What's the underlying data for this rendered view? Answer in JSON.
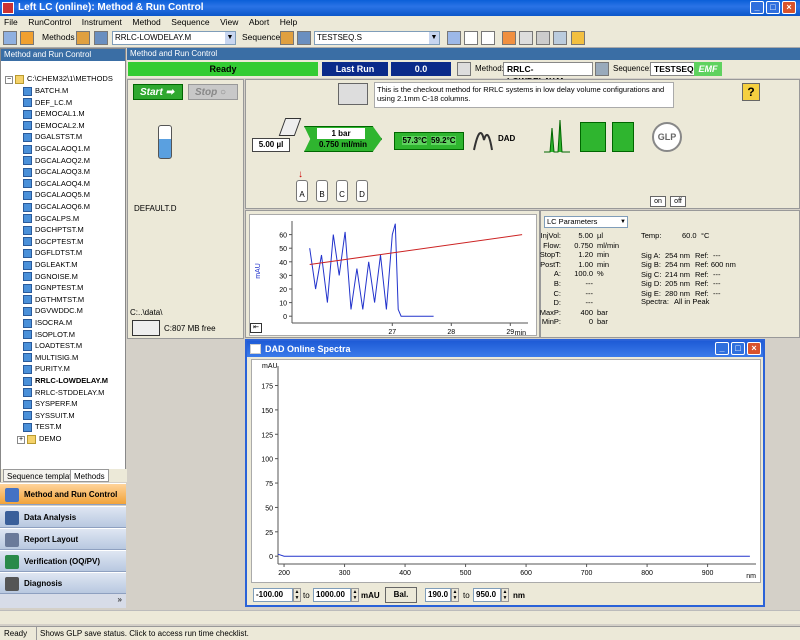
{
  "window": {
    "title": "Left LC (online): Method & Run Control"
  },
  "menu": [
    "File",
    "RunControl",
    "Instrument",
    "Method",
    "Sequence",
    "View",
    "Abort",
    "Help"
  ],
  "toolbar": {
    "methods_label": "Methods",
    "method_value": "RRLC-LOWDELAY.M",
    "sequences_label": "Sequences",
    "sequence_value": "TESTSEQ.S"
  },
  "leftpanel": {
    "header": "Method and Run Control",
    "root": "C:\\CHEM32\\1\\METHODS",
    "items": [
      "BATCH.M",
      "DEF_LC.M",
      "DEMOCAL1.M",
      "DEMOCAL2.M",
      "DGALSTST.M",
      "DGCALAOQ1.M",
      "DGCALAOQ2.M",
      "DGCALAOQ3.M",
      "DGCALAOQ4.M",
      "DGCALAOQ5.M",
      "DGCALAOQ6.M",
      "DGCALPS.M",
      "DGCHPTST.M",
      "DGCPTEST.M",
      "DGFLDTST.M",
      "DGLEAKT.M",
      "DGNOISE.M",
      "DGNPTEST.M",
      "DGTHMTST.M",
      "DGVWDDC.M",
      "ISOCRA.M",
      "ISOPLOT.M",
      "LOADTEST.M",
      "MULTISIG.M",
      "PURITY.M",
      "RRLC-LOWDELAY.M",
      "RRLC-STDDELAY.M",
      "SYSPERF.M",
      "SYSSUIT.M",
      "TEST.M"
    ],
    "folder": "DEMO",
    "tabs": [
      "Sequence templates",
      "Methods"
    ]
  },
  "nav": [
    "Method and Run Control",
    "Data Analysis",
    "Report Layout",
    "Verification (OQ/PV)",
    "Diagnosis"
  ],
  "main": {
    "header": "Method and Run Control",
    "status": "Ready",
    "last_run_label": "Last Run",
    "last_run_value": "0.0",
    "method_label": "Method:",
    "method_value": "RRLC-LOWDELAY.M",
    "sequence_label": "Sequence:",
    "sequence_value": "TESTSEQ.S",
    "emf": "EMF",
    "start": "Start",
    "stop": "Stop",
    "data_file": "DEFAULT.D",
    "data_path": "C:..\\data\\",
    "disk_free": "C:807 MB free",
    "description": "This is the checkout method for RRLC systems in low delay volume configurations and using 2.1mm C-18 columns.",
    "injector": "5.00 µl",
    "pressure": "1 bar",
    "flow": "0.750 ml/min",
    "temp_left": "57.3°C",
    "temp_right": "59.2°C",
    "dad": "DAD",
    "glp": "GLP",
    "bottles": [
      "A",
      "B",
      "C",
      "D"
    ],
    "on": "on",
    "off": "off",
    "help": "?"
  },
  "lc_params": {
    "dropdown": "LC Parameters",
    "rows": [
      {
        "k": "InjVol:",
        "v": "5.00",
        "u": "µl"
      },
      {
        "k": "Flow:",
        "v": "0.750",
        "u": "ml/min"
      },
      {
        "k": "StopT:",
        "v": "1.20",
        "u": "min"
      },
      {
        "k": "PostT:",
        "v": "1.00",
        "u": "min"
      },
      {
        "k": "A:",
        "v": "100.0",
        "u": "%"
      },
      {
        "k": "B:",
        "v": "---",
        "u": ""
      },
      {
        "k": "C:",
        "v": "---",
        "u": ""
      },
      {
        "k": "D:",
        "v": "---",
        "u": ""
      },
      {
        "k": "MaxP:",
        "v": "400",
        "u": "bar"
      },
      {
        "k": "MinP:",
        "v": "0",
        "u": "bar"
      }
    ],
    "temp_label": "Temp:",
    "temp_value": "60.0",
    "temp_unit": "°C",
    "signals": [
      {
        "k": "Sig A:",
        "v": "254 nm",
        "r": "Ref:",
        "rv": "---"
      },
      {
        "k": "Sig B:",
        "v": "254 nm",
        "r": "Ref: 600 nm",
        "rv": ""
      },
      {
        "k": "Sig C:",
        "v": "214 nm",
        "r": "Ref:",
        "rv": "---"
      },
      {
        "k": "Sig D:",
        "v": "205 nm",
        "r": "Ref:",
        "rv": "---"
      },
      {
        "k": "Sig E:",
        "v": "280 nm",
        "r": "Ref:",
        "rv": "---"
      }
    ],
    "spectra_label": "Spectra:",
    "spectra_value": "All in Peak"
  },
  "chart_data": [
    {
      "type": "line",
      "ylabel": "mAU",
      "xlabel": "min",
      "xlim": [
        25.3,
        29.3
      ],
      "ylim": [
        -5,
        70
      ],
      "yticks": [
        0,
        10,
        20,
        30,
        40,
        50,
        60
      ],
      "xticks": [
        27,
        28,
        29
      ],
      "series": [
        {
          "color": "#2233cc",
          "x": [
            25.6,
            25.7,
            25.8,
            25.9,
            26.0,
            26.1,
            26.2,
            26.3,
            26.4,
            26.5,
            26.6,
            26.7,
            26.8,
            26.9,
            27.0,
            27.05,
            27.1,
            27.15,
            27.2,
            27.3,
            27.5,
            27.6,
            27.7
          ],
          "y": [
            50,
            20,
            45,
            10,
            60,
            30,
            62,
            5,
            35,
            5,
            40,
            10,
            45,
            5,
            60,
            68,
            5,
            0,
            0,
            0,
            0,
            0,
            0
          ]
        },
        {
          "color": "#cc2222",
          "x": [
            25.6,
            29.2
          ],
          "y": [
            38,
            60
          ]
        }
      ]
    },
    {
      "type": "line",
      "ylabel": "mAU",
      "xlabel": "nm",
      "xlim": [
        190,
        980
      ],
      "ylim": [
        -8,
        195
      ],
      "yticks": [
        0,
        25,
        50,
        75,
        100,
        125,
        150,
        175
      ],
      "xticks": [
        200,
        300,
        400,
        500,
        600,
        700,
        800,
        900
      ],
      "series": [
        {
          "color": "#2233cc",
          "x": [
            190,
            200,
            210,
            970
          ],
          "y": [
            2,
            0,
            0,
            0
          ]
        }
      ]
    }
  ],
  "dad": {
    "title": "DAD Online Spectra",
    "ymin": "-100.00",
    "to": "to",
    "ymax": "1000.00",
    "yunit": "mAU",
    "bal": "Bal.",
    "xmin": "190.0",
    "to2": "to",
    "xmax": "950.0",
    "xunit": "nm"
  },
  "statusbar": {
    "state": "Ready",
    "message": "Shows GLP save status. Click to access run time checklist."
  }
}
